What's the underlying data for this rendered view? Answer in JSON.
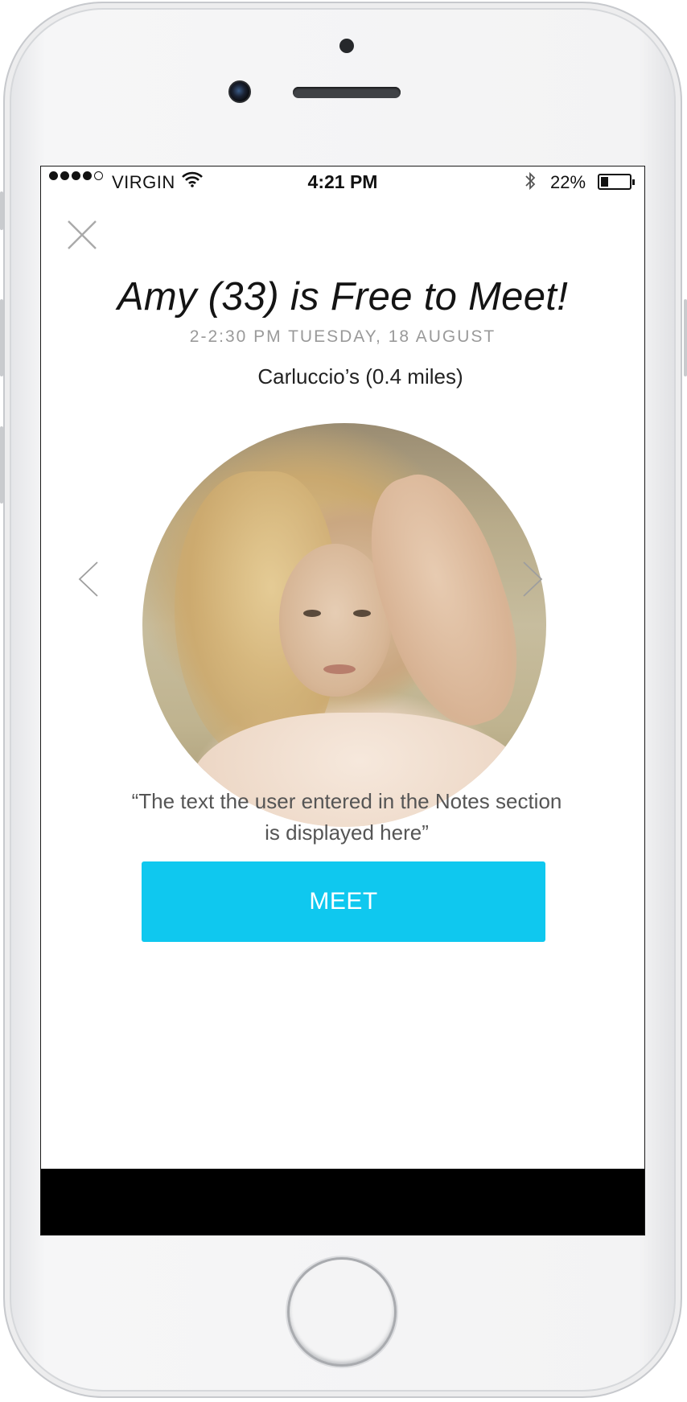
{
  "status_bar": {
    "carrier": "VIRGIN",
    "time": "4:21 PM",
    "battery_percent": "22%",
    "battery_level": 0.22,
    "signal_bars_filled": 4,
    "signal_bars_total": 5
  },
  "header": {
    "title": "Amy (33) is Free to Meet!",
    "subtitle": "2-2:30 PM TUESDAY, 18 AUGUST",
    "venue": "Carluccio’s (0.4 miles)"
  },
  "profile": {
    "notes": "“The text the user entered in the Notes section is displayed here”"
  },
  "actions": {
    "meet_label": "MEET"
  },
  "colors": {
    "accent": "#0fc8ef",
    "title_text": "#141414",
    "subtitle_text": "#9a9a9a"
  },
  "icons": {
    "close": "close-icon",
    "prev": "chevron-left-icon",
    "next": "chevron-right-icon",
    "wifi": "wifi-icon",
    "bluetooth": "bluetooth-icon",
    "battery": "battery-icon"
  }
}
